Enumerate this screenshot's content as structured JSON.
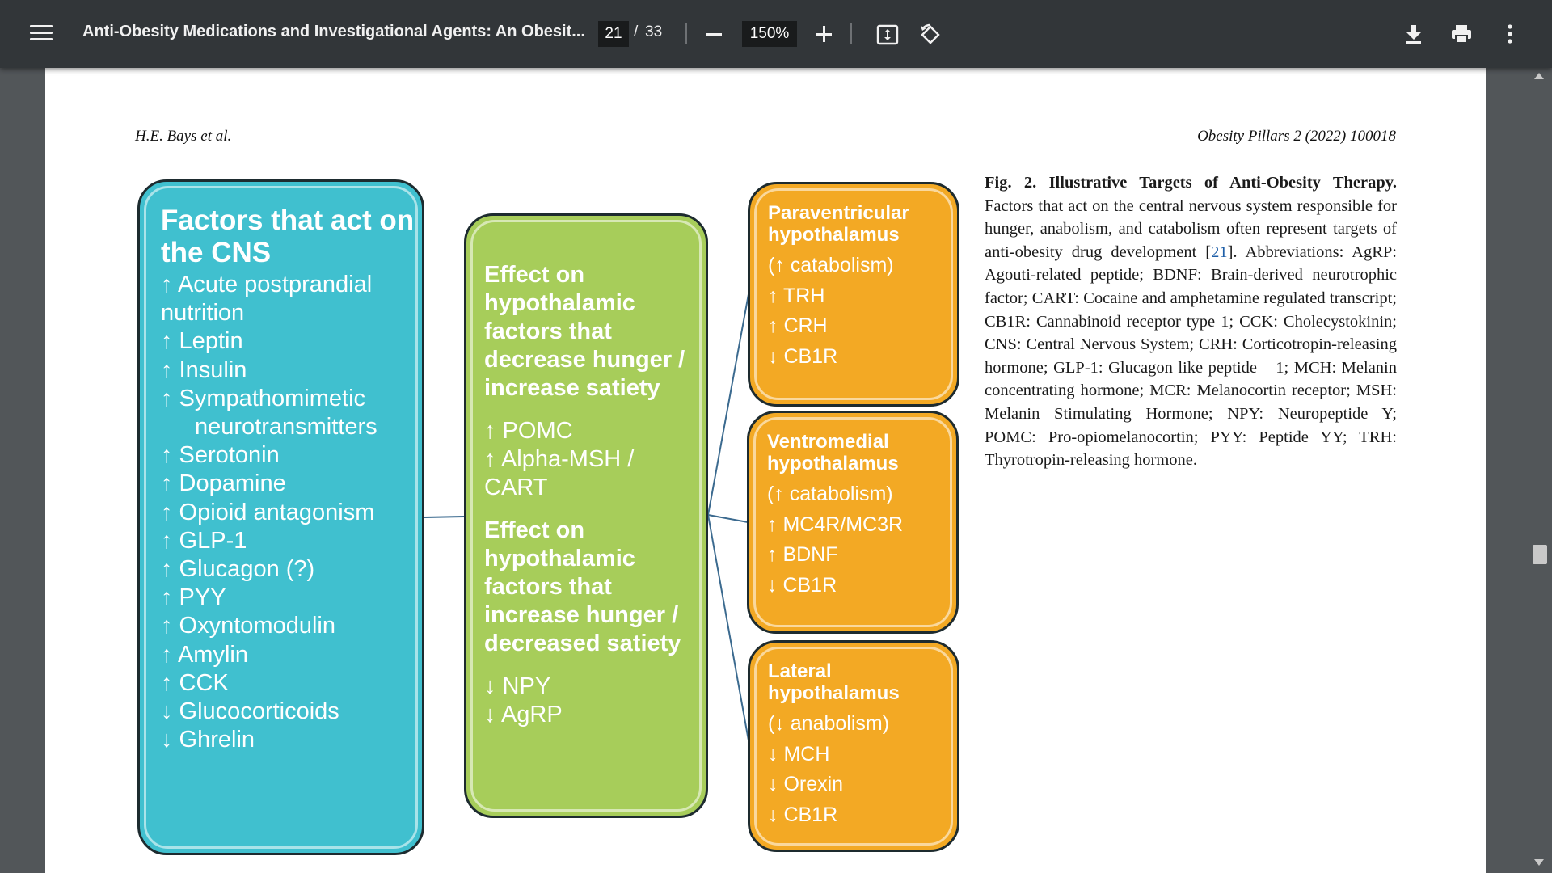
{
  "toolbar": {
    "title": "Anti-Obesity Medications and Investigational Agents: An Obesit...",
    "page_current": "21",
    "page_separator": "/",
    "page_total": "33",
    "zoom": "150%",
    "icons": [
      "menu-icon",
      "zoom-out-icon",
      "zoom-in-icon",
      "fit-page-icon",
      "rotate-icon",
      "download-icon",
      "print-icon",
      "more-options-icon"
    ]
  },
  "page": {
    "header_left": "H.E. Bays et al.",
    "header_right": "Obesity Pillars 2 (2022) 100018"
  },
  "diagram": {
    "cns": {
      "title": "Factors that act on the CNS",
      "items": [
        "↑ Acute postprandial nutrition",
        "↑ Leptin",
        "↑ Insulin",
        "↑ Sympathomimetic",
        "neurotransmitters",
        "↑ Serotonin",
        "↑ Dopamine",
        "↑ Opioid antagonism",
        "↑ GLP-1",
        "↑ Glucagon (?)",
        "↑ PYY",
        "↑ Oxyntomodulin",
        "↑ Amylin",
        "↑ CCK",
        "↓ Glucocorticoids",
        "↓ Ghrelin"
      ]
    },
    "middle": {
      "heading1": "Effect on hypothalamic factors that decrease hunger / increase satiety",
      "items1": [
        "↑ POMC",
        "↑ Alpha-MSH / CART"
      ],
      "heading2": "Effect on hypothalamic factors that increase hunger / decreased satiety",
      "items2": [
        "↓ NPY",
        "↓ AgRP"
      ]
    },
    "paraventricular": {
      "title": "Paraventricular hypothalamus",
      "sub": "(↑ catabolism)",
      "items": [
        "↑ TRH",
        "↑ CRH",
        "↓ CB1R"
      ]
    },
    "ventromedial": {
      "title": "Ventromedial hypothalamus",
      "sub": "(↑ catabolism)",
      "items": [
        "↑ MC4R/MC3R",
        "↑ BDNF",
        "↓ CB1R"
      ]
    },
    "lateral": {
      "title": "Lateral hypothalamus",
      "sub": "(↓ anabolism)",
      "items": [
        "↓ MCH",
        "↓ Orexin",
        "↓ CB1R"
      ]
    }
  },
  "caption": {
    "label": "Fig. 2. Illustrative Targets of Anti-Obesity Therapy.",
    "text1": " Factors that act on the central nervous system responsible for hunger, anabolism, and catabolism often represent targets of anti-obesity drug development [",
    "ref": "21",
    "text2": "]. Abbreviations: AgRP: Agouti-related peptide; BDNF: Brain-derived neurotrophic factor; CART: Cocaine and amphetamine regulated transcript; CB1R: Cannabinoid receptor type 1; CCK: Cholecystokinin; CNS: Central Nervous System; CRH: Corticotropin-releasing hormone; GLP-1: Glucagon like peptide – 1; MCH: Melanin concentrating hormone; MCR: Melanocortin receptor; MSH: Melanin Stimulating Hormone; NPY: Neuropeptide Y; POMC: Pro-opiomelanocortin; PYY: Peptide YY; TRH: Thyrotropin-releasing hormone."
  },
  "colors": {
    "toolbar": "#323639",
    "viewer_bg": "#525659",
    "cns_box": "#40c0cf",
    "middle_box": "#a7cd5a",
    "hypothalamus_box": "#f3a924",
    "reference_link": "#1f5fa8"
  }
}
